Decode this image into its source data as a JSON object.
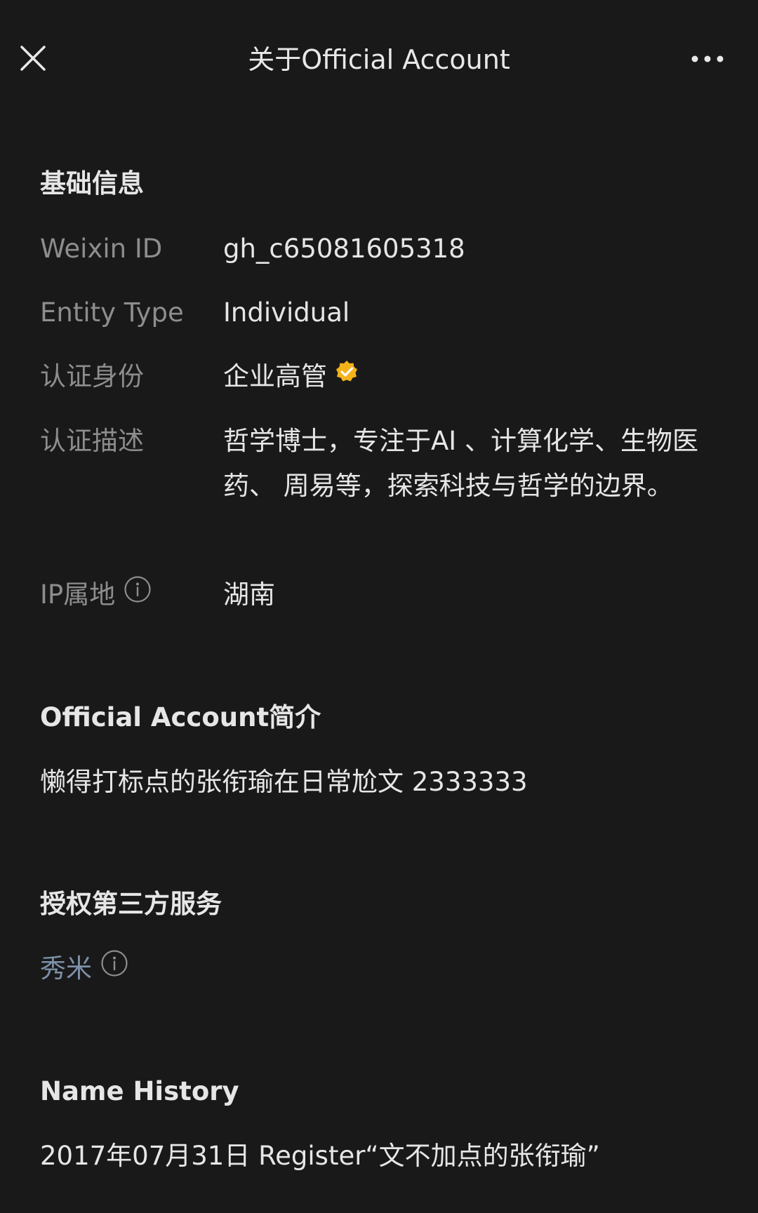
{
  "header": {
    "title": "关于Official Account"
  },
  "basic_info": {
    "title": "基础信息",
    "weixin_id": {
      "label": "Weixin ID",
      "value": "gh_c65081605318"
    },
    "entity_type": {
      "label": "Entity Type",
      "value": "Individual"
    },
    "cert_identity": {
      "label": "认证身份",
      "value": "企业高管"
    },
    "cert_description": {
      "label": "认证描述",
      "value": "哲学博士，专注于AI 、计算化学、生物医药、 周易等，探索科技与哲学的边界。"
    },
    "ip_location": {
      "label": "IP属地",
      "value": "湖南"
    }
  },
  "intro": {
    "title": "Official Account简介",
    "text": "懒得打标点的张衔瑜在日常尬文 2333333"
  },
  "third_party": {
    "title": "授权第三方服务",
    "service": "秀米"
  },
  "name_history": {
    "title": "Name History",
    "entry": "2017年07月31日 Register“文不加点的张衔瑜”"
  },
  "colors": {
    "background": "#191919",
    "label": "#8d8d8d",
    "text": "#e6e6e6",
    "link": "#7d90a9",
    "verified_badge": "#f5b21b"
  }
}
